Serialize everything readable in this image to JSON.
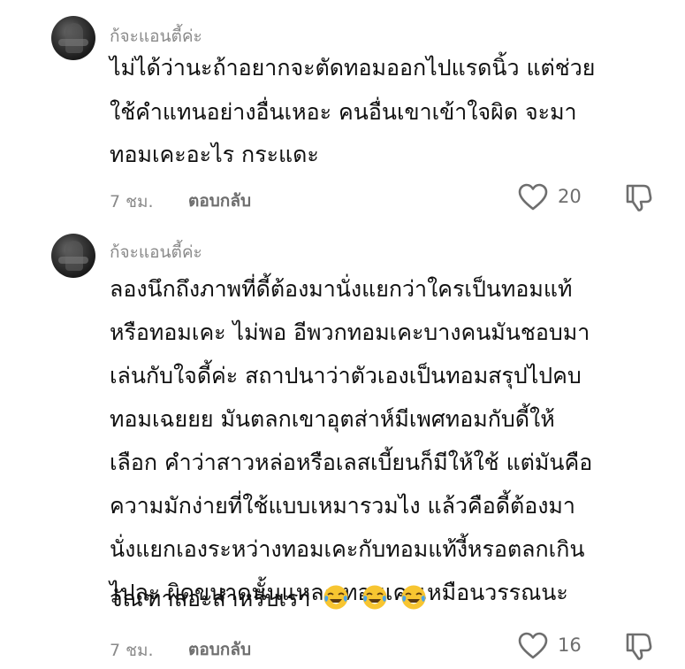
{
  "comments": [
    {
      "username": "ก้จะแอนตี้ค่ะ",
      "lines": [
        "ไม่ได้ว่านะถ้าอยากจะตัดทอมออกไปแรดนิ้ว แต่ช่วย",
        "ใช้คำแทนอย่างอื่นเหอะ คนอื่นเขาเข้าใจผิด จะมา",
        "ทอมเคะอะไร กระแดะ"
      ],
      "time": "7 ชม.",
      "reply_label": "ตอบกลับ",
      "like_count": "20",
      "like_icon": "heart-outline-icon",
      "dislike_icon": "thumbs-down-icon"
    },
    {
      "username": "ก้จะแอนตี้ค่ะ",
      "lines": [
        "ลองนึกถึงภาพที่ดี้ต้องมานั่งแยกว่าใครเป็นทอมแท้",
        "หรือทอมเคะ ไม่พอ อีพวกทอมเคะบางคนมันชอบมา",
        "เล่นกับใจดี้ค่ะ สถาปนาว่าตัวเองเป็นทอมสรุปไปคบ",
        "ทอมเฉยยย มันตลกเขาอุตส่าห์มีเพศทอมกับดี้ให้",
        "เลือก คำว่าสาวหล่อหรือเลสเบี้ยนก็มีให้ใช้ แต่มันคือ",
        "ความมักง่ายที่ใช้แบบเหมารวมไง แล้วคือดี้ต้องมา",
        "นั่งแยกเองระหว่างทอมเคะกับทอมแท้งี้หรอตลกเกิน",
        "ไปละ ผิดขนาดนั้นแหละ ทอมเคะเหมือนวรรณนะ",
        "จัณฑาลอะสำหรับเรา"
      ],
      "emojis": [
        "face-with-tears-of-joy-emoji",
        "face-with-tears-of-joy-emoji",
        "face-with-tears-of-joy-emoji"
      ],
      "time": "7 ชม.",
      "reply_label": "ตอบกลับ",
      "like_count": "16",
      "like_icon": "heart-outline-icon",
      "dislike_icon": "thumbs-down-icon"
    }
  ],
  "colors": {
    "text": "#111111",
    "muted": "#8a8a8a",
    "icon": "#6e6e6e"
  }
}
